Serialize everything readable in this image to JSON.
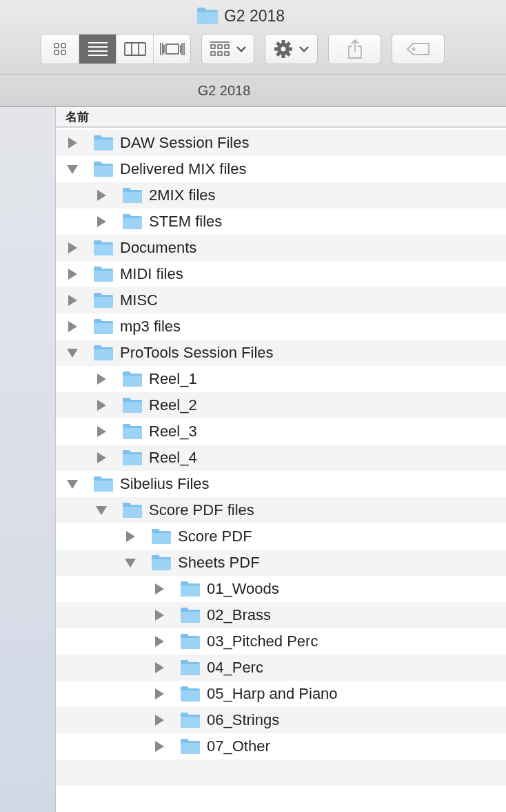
{
  "window": {
    "title": "G2 2018"
  },
  "toolbar": {
    "view_modes": [
      {
        "kind": "icons",
        "selected": false
      },
      {
        "kind": "list",
        "selected": true
      },
      {
        "kind": "columns",
        "selected": false
      },
      {
        "kind": "gallery",
        "selected": false
      }
    ]
  },
  "path_bar": {
    "title": "G2 2018"
  },
  "table": {
    "columns": [
      "名前"
    ],
    "rows": [
      {
        "name": "DAW Session Files",
        "expanded": false
      },
      {
        "name": "Delivered MIX files",
        "expanded": true,
        "children": [
          {
            "name": "2MIX files",
            "expanded": false
          },
          {
            "name": "STEM files",
            "expanded": false
          }
        ]
      },
      {
        "name": "Documents",
        "expanded": false
      },
      {
        "name": "MIDI files",
        "expanded": false
      },
      {
        "name": "MISC",
        "expanded": false
      },
      {
        "name": "mp3 files",
        "expanded": false
      },
      {
        "name": "ProTools Session Files",
        "expanded": true,
        "children": [
          {
            "name": "Reel_1",
            "expanded": false
          },
          {
            "name": "Reel_2",
            "expanded": false
          },
          {
            "name": "Reel_3",
            "expanded": false
          },
          {
            "name": "Reel_4",
            "expanded": false
          }
        ]
      },
      {
        "name": "Sibelius Files",
        "expanded": true,
        "children": [
          {
            "name": "Score PDF files",
            "expanded": true,
            "children": [
              {
                "name": "Score PDF",
                "expanded": false
              },
              {
                "name": "Sheets PDF",
                "expanded": true,
                "children": [
                  {
                    "name": "01_Woods",
                    "expanded": false
                  },
                  {
                    "name": "02_Brass",
                    "expanded": false
                  },
                  {
                    "name": "03_Pitched Perc",
                    "expanded": false
                  },
                  {
                    "name": "04_Perc",
                    "expanded": false
                  },
                  {
                    "name": "05_Harp and Piano",
                    "expanded": false
                  },
                  {
                    "name": "06_Strings",
                    "expanded": false
                  },
                  {
                    "name": "07_Other",
                    "expanded": false
                  }
                ]
              }
            ]
          }
        ]
      }
    ]
  }
}
